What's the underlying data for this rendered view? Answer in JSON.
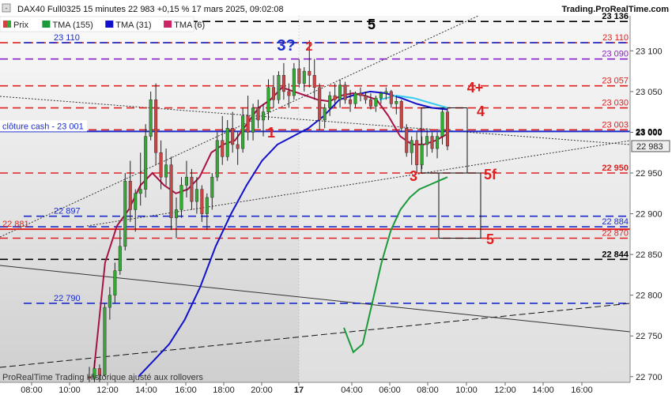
{
  "header": {
    "instrument_line": "DAX40 Full0325 15 minutes 22 983 +0,15 % 17 mars 2025, 09:02:08",
    "brand": "Trading.ProRealTime.com"
  },
  "legend": [
    {
      "label": "Prix",
      "color": "#cc4444",
      "color2": "#33aa33"
    },
    {
      "label": "TMA (155)",
      "color": "#1a9a3a"
    },
    {
      "label": "TMA (31)",
      "color": "#1111cc"
    },
    {
      "label": "TMA (6)",
      "color": "#cc2266"
    }
  ],
  "footer": "ProRealTime Trading Historique ajusté aux rollovers",
  "cash_close_label": "clôture cash -  23 001",
  "chart_data": {
    "type": "candlestick",
    "ylim": [
      22693,
      23143
    ],
    "y_ticks": [
      22700,
      22750,
      22800,
      22850,
      22900,
      22950,
      23000,
      23050,
      23100
    ],
    "y_tick_labels": [
      "22 700",
      "22 750",
      "22 800",
      "22 850",
      "22 900",
      "22 950",
      "23 000",
      "23 050",
      "23 100"
    ],
    "x_tick_labels": [
      "08:00",
      "10:00",
      "12:00",
      "14:00",
      "16:00",
      "18:00",
      "20:00",
      "17",
      "04:00",
      "06:00",
      "08:00",
      "10:00",
      "12:00",
      "14:00",
      "16:00"
    ],
    "current_price": {
      "value": 22983,
      "label": "22 983"
    },
    "levels": [
      {
        "value": 23136,
        "label": "23 136",
        "color": "#000000",
        "style": "dash",
        "label_side": "right"
      },
      {
        "value": 23110,
        "label": "23 110",
        "color": "#e02020",
        "style": "dash",
        "label_side": "right"
      },
      {
        "value": 23110,
        "label": "23 110",
        "color": "#1a2ccc",
        "style": "dash",
        "label_side": "left"
      },
      {
        "value": 23090,
        "label": "23 090",
        "color": "#8a20c8",
        "style": "dash",
        "label_side": "right"
      },
      {
        "value": 23057,
        "label": "23 057",
        "color": "#e02020",
        "style": "dash",
        "label_side": "right"
      },
      {
        "value": 23030,
        "label": "23 030",
        "color": "#e02020",
        "style": "dash",
        "label_side": "right"
      },
      {
        "value": 23003,
        "label": "23 003",
        "color": "#e02020",
        "style": "dash",
        "label_side": "right"
      },
      {
        "value": 23001,
        "label": "23 000",
        "color": "#1a2ccc",
        "style": "solid",
        "label_side": "right"
      },
      {
        "value": 22950,
        "label": "22 950",
        "color": "#e02020",
        "style": "dash",
        "label_side": "right"
      },
      {
        "value": 22897,
        "label": "22 897",
        "color": "#1a2ccc",
        "style": "dash",
        "label_side": "left"
      },
      {
        "value": 22884,
        "label": "22 884",
        "color": "#1a2ccc",
        "style": "dash",
        "label_side": "right"
      },
      {
        "value": 22881,
        "label": "22 881",
        "color": "#e02020",
        "style": "solid",
        "label_side": "left"
      },
      {
        "value": 22870,
        "label": "22 870",
        "color": "#e02020",
        "style": "dash",
        "label_side": "right"
      },
      {
        "value": 22844,
        "label": "22 844",
        "color": "#000000",
        "style": "dash",
        "label_side": "right"
      },
      {
        "value": 22790,
        "label": "22 790",
        "color": "#1a2ccc",
        "style": "dash",
        "label_side": "left"
      }
    ],
    "annotations": [
      {
        "text": "5",
        "color": "#000000"
      },
      {
        "text": "3?",
        "color": "#1a2ccc"
      },
      {
        "text": "2",
        "color": "#e02020"
      },
      {
        "text": "4+",
        "color": "#e02020"
      },
      {
        "text": "4",
        "color": "#e02020"
      },
      {
        "text": "1",
        "color": "#e02020"
      },
      {
        "text": "3",
        "color": "#e02020"
      },
      {
        "text": "5f",
        "color": "#e02020"
      },
      {
        "text": "5",
        "color": "#e02020"
      }
    ],
    "candles": [
      [
        22700,
        22712,
        22688,
        22698
      ],
      [
        22698,
        22720,
        22690,
        22710
      ],
      [
        22710,
        22715,
        22693,
        22702
      ],
      [
        22702,
        22790,
        22700,
        22785
      ],
      [
        22785,
        22810,
        22770,
        22800
      ],
      [
        22800,
        22840,
        22790,
        22830
      ],
      [
        22830,
        22880,
        22825,
        22860
      ],
      [
        22860,
        22950,
        22855,
        22940
      ],
      [
        22940,
        22965,
        22890,
        22905
      ],
      [
        22905,
        22930,
        22878,
        22925
      ],
      [
        22925,
        22975,
        22910,
        22930
      ],
      [
        22930,
        23010,
        22920,
        22995
      ],
      [
        22995,
        23050,
        22990,
        23040
      ],
      [
        23040,
        23060,
        22960,
        22975
      ],
      [
        22975,
        22990,
        22930,
        22945
      ],
      [
        22945,
        22980,
        22935,
        22960
      ],
      [
        22960,
        22970,
        22880,
        22895
      ],
      [
        22895,
        22920,
        22870,
        22905
      ],
      [
        22905,
        22945,
        22895,
        22935
      ],
      [
        22935,
        22965,
        22920,
        22945
      ],
      [
        22945,
        22955,
        22905,
        22915
      ],
      [
        22915,
        22945,
        22900,
        22930
      ],
      [
        22930,
        22935,
        22890,
        22900
      ],
      [
        22900,
        22925,
        22880,
        22920
      ],
      [
        22920,
        22950,
        22905,
        22945
      ],
      [
        22945,
        23000,
        22940,
        22990
      ],
      [
        22990,
        23020,
        22960,
        22970
      ],
      [
        22970,
        23015,
        22965,
        23005
      ],
      [
        23005,
        23025,
        22975,
        22985
      ],
      [
        22985,
        23000,
        22960,
        22980
      ],
      [
        22980,
        23030,
        22975,
        23020
      ],
      [
        23020,
        23045,
        22990,
        23000
      ],
      [
        23000,
        23035,
        22990,
        23030
      ],
      [
        23030,
        23040,
        23005,
        23015
      ],
      [
        23015,
        23035,
        22995,
        23025
      ],
      [
        23025,
        23065,
        23015,
        23055
      ],
      [
        23055,
        23070,
        23030,
        23040
      ],
      [
        23040,
        23075,
        23035,
        23070
      ],
      [
        23070,
        23085,
        23040,
        23050
      ],
      [
        23050,
        23060,
        23030,
        23045
      ],
      [
        23045,
        23085,
        23040,
        23078
      ],
      [
        23078,
        23090,
        23055,
        23060
      ],
      [
        23060,
        23080,
        23050,
        23075
      ],
      [
        23075,
        23113,
        23055,
        23070
      ],
      [
        23070,
        23090,
        23040,
        23055
      ],
      [
        23055,
        23060,
        23003,
        23015
      ],
      [
        23015,
        23035,
        23005,
        23030
      ],
      [
        23030,
        23050,
        23020,
        23045
      ],
      [
        23045,
        23060,
        23030,
        23040
      ],
      [
        23040,
        23065,
        23030,
        23058
      ],
      [
        23058,
        23062,
        23035,
        23040
      ],
      [
        23040,
        23052,
        23025,
        23035
      ],
      [
        23035,
        23050,
        23030,
        23048
      ],
      [
        23048,
        23055,
        23038,
        23045
      ],
      [
        23045,
        23050,
        23035,
        23040
      ],
      [
        23040,
        23048,
        23028,
        23032
      ],
      [
        23032,
        23045,
        23025,
        23042
      ],
      [
        23042,
        23050,
        23035,
        23048
      ],
      [
        23048,
        23055,
        23040,
        23050
      ],
      [
        23050,
        23052,
        23030,
        23035
      ],
      [
        23035,
        23045,
        23022,
        23038
      ],
      [
        23038,
        23040,
        23000,
        23005
      ],
      [
        23005,
        23010,
        22970,
        22975
      ],
      [
        22975,
        22995,
        22960,
        22990
      ],
      [
        22990,
        23000,
        22950,
        22960
      ],
      [
        22960,
        22995,
        22955,
        22985
      ],
      [
        22985,
        23005,
        22970,
        22995
      ],
      [
        22995,
        23000,
        22975,
        22980
      ],
      [
        22980,
        23000,
        22968,
        22995
      ],
      [
        22995,
        23030,
        22985,
        23025
      ],
      [
        23025,
        23030,
        22978,
        22983
      ]
    ],
    "tma155": [
      22760,
      22730,
      22740,
      22790,
      22840,
      22880,
      22905,
      22920,
      22930,
      22935,
      22940,
      22945
    ],
    "tma31": [
      22700,
      22720,
      22740,
      22770,
      22810,
      22860,
      22900,
      22935,
      22965,
      22985,
      22995,
      23005,
      23020,
      23040,
      23046,
      23050,
      23048,
      23042,
      23035,
      23030,
      23028
    ],
    "tma6": [
      22700,
      22840,
      22885,
      22905,
      22935,
      22950,
      22935,
      22925,
      22930,
      22945,
      22975,
      22985,
      22990,
      23010,
      23030,
      23040,
      23055,
      23050,
      23045,
      23040,
      23038,
      23045,
      23048,
      23045,
      23040,
      23020,
      22995,
      22985,
      22985,
      22990,
      22998
    ],
    "tma6_projection": [
      23040,
      23045,
      23042,
      23036,
      23030
    ]
  }
}
